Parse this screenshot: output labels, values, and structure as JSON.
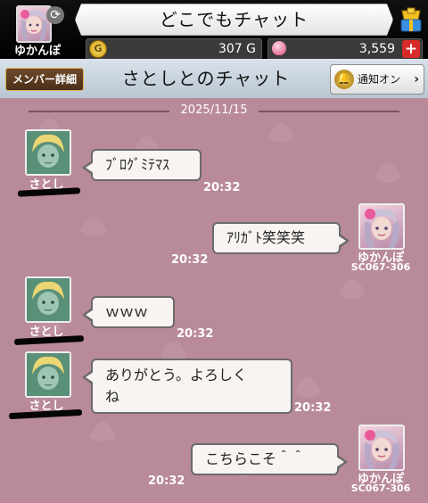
{
  "header": {
    "title": "どこでもチャット",
    "user_name": "ゆかんぽ",
    "gold": "307 G",
    "gems": "3,559",
    "plus": "+",
    "coin_icon": "coin-icon",
    "gem_icon": "gem-icon",
    "gift_icon": "gift-icon",
    "sync_icon": "sync-icon"
  },
  "subheader": {
    "member_button": "メンバー詳細",
    "chat_title": "さとしとのチャット",
    "notify_label": "通知オン",
    "chevron": "›"
  },
  "chat": {
    "date": "2025/11/15",
    "messages": [
      {
        "side": "left",
        "sender": "さとし",
        "text": "ﾌﾞﾛｸﾞﾐﾃﾏｽ",
        "time": "20:32"
      },
      {
        "side": "right",
        "sender": "ゆかんぽ",
        "code": "SC067-306",
        "text": "ｱﾘｶﾞﾄ笑笑笑",
        "time": "20:32"
      },
      {
        "side": "left",
        "sender": "さとし",
        "text": "ｗｗｗ",
        "time": "20:32"
      },
      {
        "side": "left",
        "sender": "さとし",
        "text": "ありがとう。よろしく\nね",
        "time": "20:32"
      },
      {
        "side": "right",
        "sender": "ゆかんぽ",
        "code": "SC067-306",
        "text": "こちらこそ＾＾",
        "time": "20:32"
      }
    ]
  },
  "colors": {
    "chat_background": "#b98a99",
    "bubble": "#f7f4f1",
    "plus_button": "#d82a2a"
  }
}
